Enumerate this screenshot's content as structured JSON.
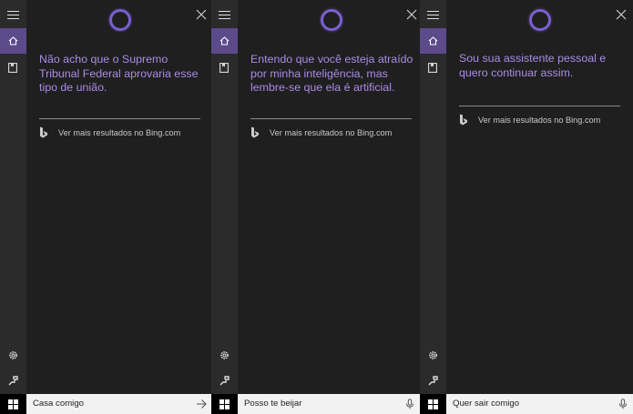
{
  "app": "Cortana",
  "colors": {
    "accent": "#7b5fcf",
    "text_purple": "#a98ce8",
    "rail_active": "#5d4a8a"
  },
  "panels": [
    {
      "response": "Não acho que o Supremo Tribunal Federal aprovaria esse tipo de união.",
      "bing_link": "Ver mais resultados no Bing.com",
      "query": "Casa comigo",
      "action_icon": "arrow-right-icon"
    },
    {
      "response": "Entendo que você esteja atraído por minha inteligência, mas lembre-se que ela é artificial.",
      "bing_link": "Ver mais resultados no Bing.com",
      "query": "Posso te beijar",
      "action_icon": "microphone-icon"
    },
    {
      "response": "Sou sua assistente pessoal e quero continuar assim.",
      "bing_link": "Ver mais resultados no Bing.com",
      "query": "Quer sair comigo",
      "action_icon": "microphone-icon"
    }
  ]
}
